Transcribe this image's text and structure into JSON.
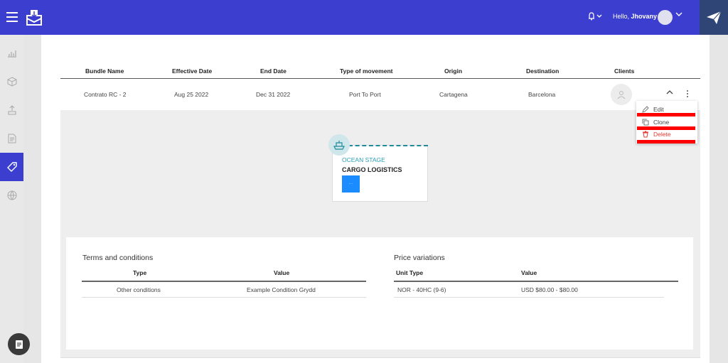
{
  "header": {
    "greeting_prefix": "Hello, ",
    "user_name": "Jhovany",
    "accent_color": "#3c3ecf",
    "icons": [
      "menu-icon",
      "logo-icon",
      "bell-icon",
      "user-avatar",
      "send-icon"
    ]
  },
  "sidebar": {
    "items": [
      {
        "icon": "chart-icon"
      },
      {
        "icon": "box-icon"
      },
      {
        "icon": "upload-icon"
      },
      {
        "icon": "document-icon"
      },
      {
        "icon": "tag-icon",
        "active": true
      },
      {
        "icon": "globe-icon"
      }
    ]
  },
  "table": {
    "columns": [
      "Bundle Name",
      "Effective Date",
      "End Date",
      "Type of movement",
      "Origin",
      "Destination",
      "Clients"
    ],
    "row": {
      "bundle_name": "Contrato RC - 2",
      "effective_date": "Aug 25 2022",
      "end_date": "Dec 31 2022",
      "movement": "Port To Port",
      "origin": "Cartagena",
      "destination": "Barcelona"
    }
  },
  "menu": {
    "edit": "Edit",
    "clone": "Clone",
    "delete": "Delete",
    "delete_color": "#e53935"
  },
  "stage": {
    "label": "OCEAN STAGE",
    "title": "CARGO LOGISTICS",
    "badge": "- -"
  },
  "terms": {
    "title": "Terms and conditions",
    "columns": [
      "Type",
      "Value"
    ],
    "rows": [
      {
        "type": "Other conditions",
        "value": "Example Condition Grydd"
      }
    ]
  },
  "prices": {
    "title": "Price variations",
    "columns": [
      "Unit Type",
      "Value"
    ],
    "rows": [
      {
        "unit": "NOR - 40HC (9-6)",
        "value": "USD $80.00 - $80.00"
      }
    ]
  }
}
